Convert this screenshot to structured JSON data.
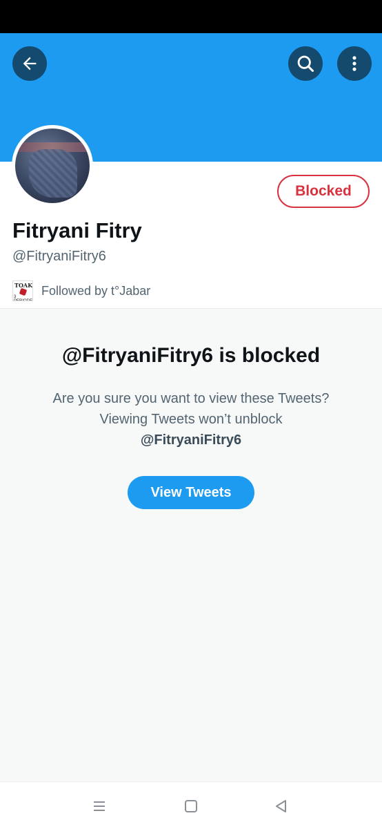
{
  "icons": {
    "back": "arrow-left-icon",
    "search": "search-icon",
    "more": "more-vertical-icon",
    "nav_menu": "menu-lines-icon",
    "nav_home": "square-icon",
    "nav_back": "triangle-back-icon"
  },
  "colors": {
    "banner": "#1d9bf0",
    "blocked": "#d8323f",
    "accent": "#1d9bf0"
  },
  "profile": {
    "display_name": "Fitryani Fitry",
    "handle": "@FitryaniFitry6",
    "blocked_label": "Blocked",
    "followed_by": "Followed by t°Jabar",
    "follower_avatar_top": "TOAK",
    "follower_avatar_bottom": "3 PERIODE"
  },
  "blocked_notice": {
    "title": "@FitryaniFitry6 is blocked",
    "description": "Are you sure you want to view these Tweets? Viewing Tweets won’t unblock",
    "description_handle": "@FitryaniFitry6",
    "button_label": "View Tweets"
  }
}
